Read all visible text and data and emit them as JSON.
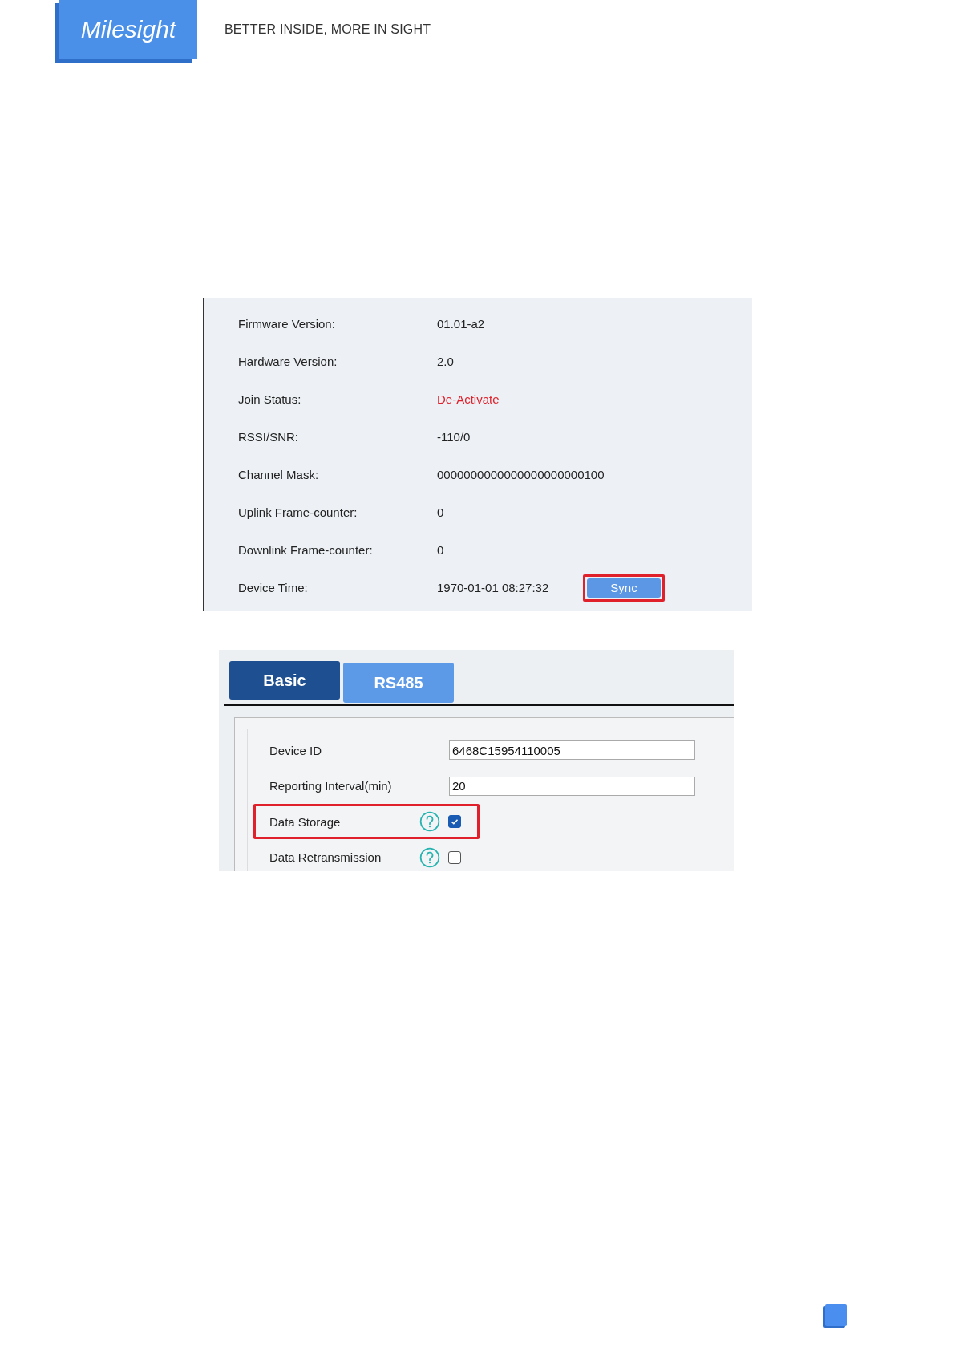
{
  "header": {
    "logo": "Milesight",
    "tagline": "BETTER INSIDE, MORE IN SIGHT"
  },
  "status_panel": {
    "rows": [
      {
        "label": "Firmware Version:",
        "value": "01.01-a2",
        "kind": "normal"
      },
      {
        "label": "Hardware Version:",
        "value": "2.0",
        "kind": "normal"
      },
      {
        "label": "Join Status:",
        "value": "De-Activate",
        "kind": "alert"
      },
      {
        "label": "RSSI/SNR:",
        "value": "-110/0",
        "kind": "normal"
      },
      {
        "label": "Channel Mask:",
        "value": "0000000000000000000000100",
        "kind": "normal"
      },
      {
        "label": "Uplink Frame-counter:",
        "value": "0",
        "kind": "normal"
      },
      {
        "label": "Downlink Frame-counter:",
        "value": "0",
        "kind": "normal"
      },
      {
        "label": "Device Time:",
        "value": "1970-01-01 08:27:32",
        "kind": "normal",
        "button": {
          "label": "Sync",
          "highlighted": true
        }
      }
    ]
  },
  "settings_panel": {
    "tabs": [
      {
        "label": "Basic",
        "selected": true
      },
      {
        "label": "RS485",
        "selected": false
      }
    ],
    "rows": [
      {
        "kind": "text",
        "label": "Device ID",
        "value": "6468C15954110005"
      },
      {
        "kind": "text",
        "label": "Reporting Interval(min)",
        "value": "20"
      },
      {
        "kind": "checkbox",
        "label": "Data Storage",
        "checked": true,
        "highlighted": true
      },
      {
        "kind": "checkbox",
        "label": "Data Retransmission",
        "checked": false,
        "highlighted": false
      }
    ]
  }
}
